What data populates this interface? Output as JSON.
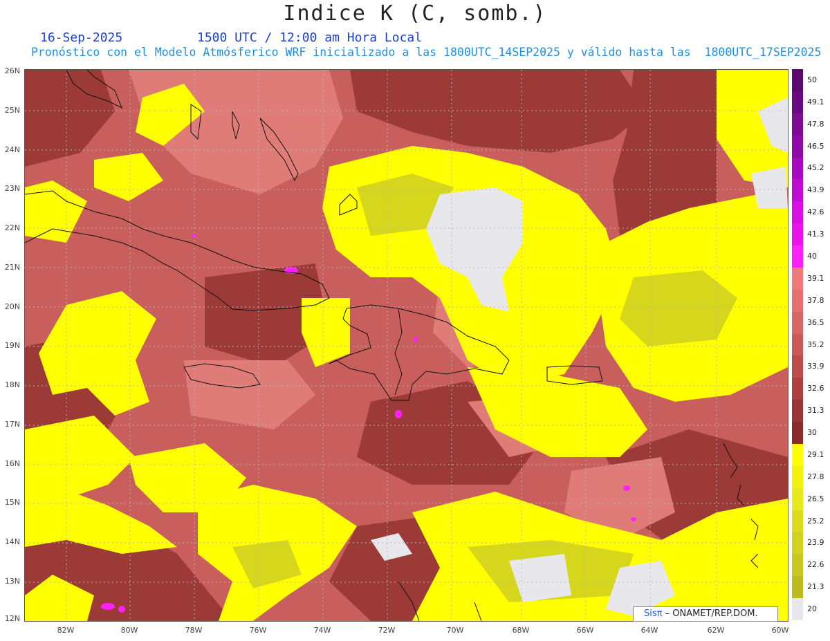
{
  "title": "Indice K (C, somb.)",
  "date": "16-Sep-2025",
  "time": "1500 UTC / 12:00 am Hora Local",
  "subtitle": "Pronóstico con el Modelo Atmósferico WRF inicializado a las 1800UTC_14SEP2025 y válido hasta las  1800UTC_17SEP2025",
  "latitude_labels": [
    "26N",
    "25N",
    "24N",
    "23N",
    "22N",
    "21N",
    "20N",
    "19N",
    "18N",
    "17N",
    "16N",
    "15N",
    "14N",
    "13N",
    "12N"
  ],
  "longitude_labels": [
    "82W",
    "80W",
    "78W",
    "76W",
    "74W",
    "72W",
    "70W",
    "68W",
    "66W",
    "64W",
    "62W",
    "60W"
  ],
  "colorbar": {
    "labels": [
      "50",
      "49.1",
      "47.8",
      "46.5",
      "45.2",
      "43.9",
      "42.6",
      "41.3",
      "40",
      "39.1",
      "37.8",
      "36.5",
      "35.2",
      "33.9",
      "32.6",
      "31.3",
      "30",
      "29.1",
      "27.8",
      "26.5",
      "25.2",
      "23.9",
      "22.6",
      "21.3",
      "20"
    ],
    "colors": [
      "#5a0a6e",
      "#6a0a80",
      "#7b0c93",
      "#900aa8",
      "#a808be",
      "#c00cd2",
      "#d80ee4",
      "#ec12f0",
      "#ff20ff",
      "#f07a7a",
      "#e67070",
      "#d96464",
      "#cc5858",
      "#bd4c4c",
      "#ad4040",
      "#9a3535",
      "#8a2c2c",
      "#ffff00",
      "#f2f20e",
      "#e8e81a",
      "#dcdc1c",
      "#d2d21e",
      "#c8c820",
      "#bcbc1e",
      "#e8e8ec"
    ]
  },
  "credit": {
    "logo": "Sisπ",
    "org": " – ONAMET/REP.DOM."
  }
}
